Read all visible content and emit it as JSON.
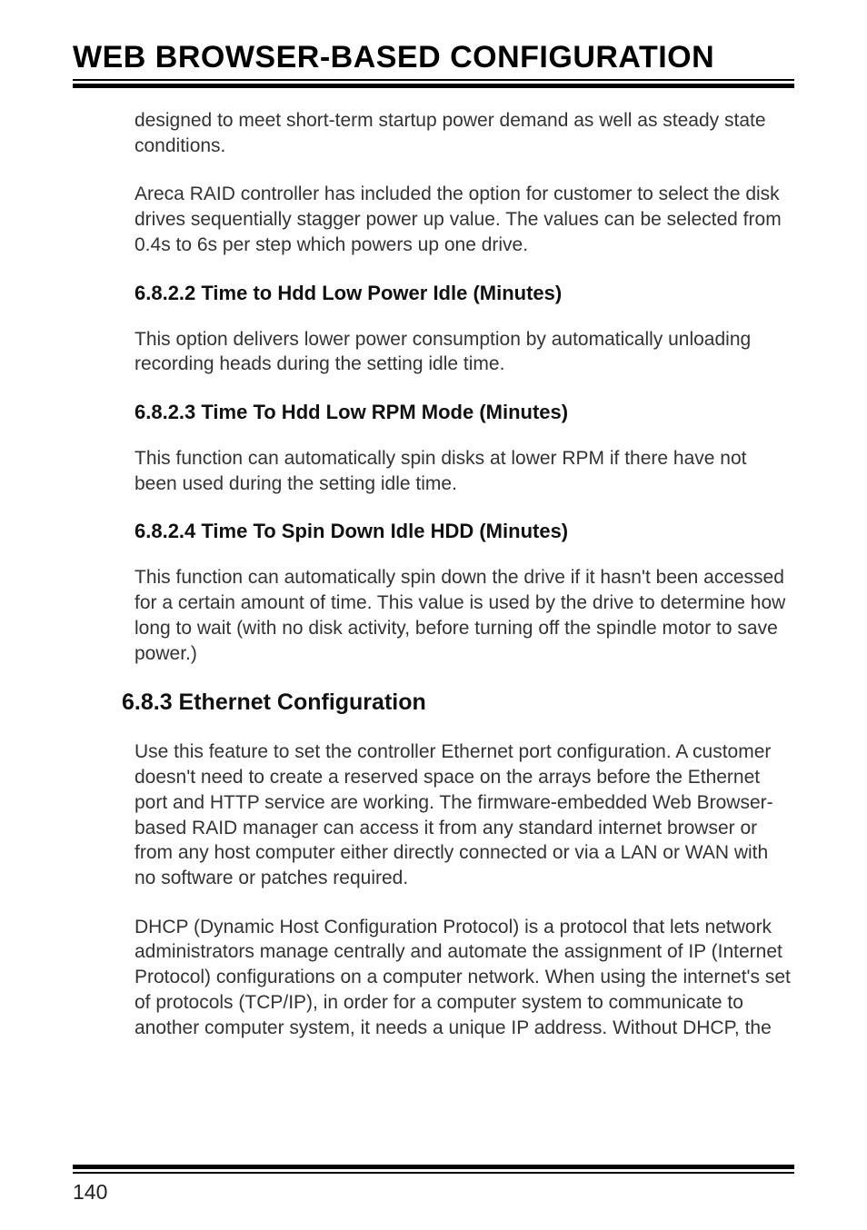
{
  "header": {
    "title": "WEB BROWSER-BASED CONFIGURATION"
  },
  "content": {
    "p1": "designed to meet short-term startup power demand as well as steady state conditions.",
    "p2": "Areca RAID controller has included the option for customer to select the disk drives sequentially stagger power up value.  The values can be selected from 0.4s to 6s per step which powers up one drive.",
    "h_6_8_2_2": "6.8.2.2 Time to Hdd Low Power Idle (Minutes)",
    "p3": "This option delivers lower power consumption by automatically unloading recording heads during the setting idle time.",
    "h_6_8_2_3": "6.8.2.3 Time To Hdd Low RPM Mode (Minutes)",
    "p4": "This function can automatically spin disks at lower RPM if there have not been used during the setting idle time.",
    "h_6_8_2_4": "6.8.2.4 Time To Spin Down Idle HDD (Minutes)",
    "p5": "This function can automatically spin down the drive if it hasn't been accessed for a certain amount of time. This value is used by the drive to determine how long to wait (with no disk activity, before turning off the spindle motor to save power.)",
    "h_6_8_3": "6.8.3 Ethernet Configuration",
    "p6": "Use this feature to set the controller Ethernet port configuration. A customer doesn't need to create a reserved space on the arrays before the Ethernet port and HTTP service are working. The firmware-embedded Web Browser-based RAID manager can access it from any standard internet browser or from any host computer either directly connected or via a LAN or WAN with no software or patches required.",
    "p7": "DHCP (Dynamic Host Configuration Protocol) is a protocol that lets network administrators manage centrally and automate the assignment of IP (Internet Protocol) configurations on a computer network. When using the internet's set of protocols (TCP/IP), in order for a computer system to communicate to another computer system, it needs a unique IP address. Without DHCP, the"
  },
  "footer": {
    "page_number": "140"
  }
}
